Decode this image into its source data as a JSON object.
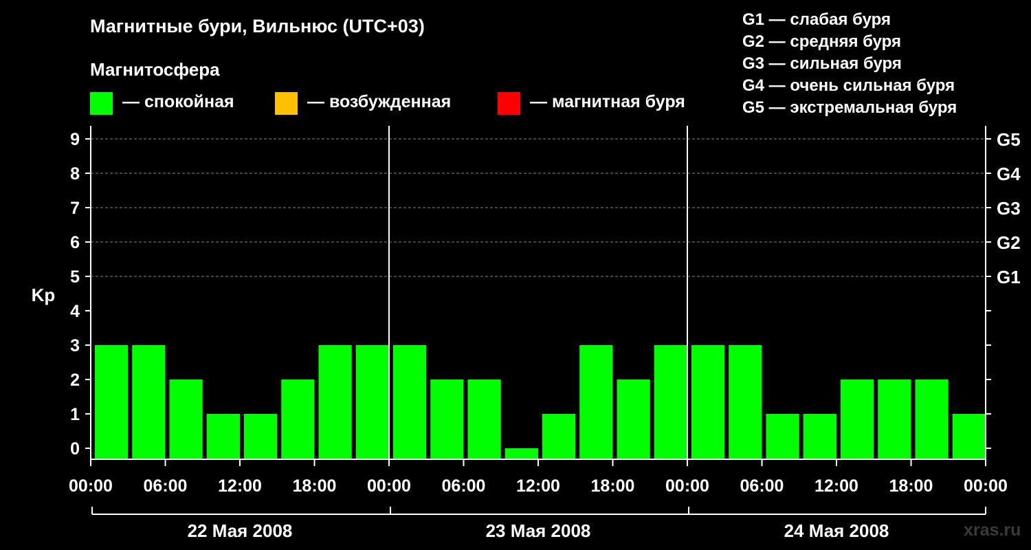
{
  "header": {
    "title": "Магнитные бури, Вильнюс (UTC+03)",
    "subtitle": "Магнитосфера"
  },
  "legend": [
    {
      "label": "— спокойная",
      "color": "#00ff00"
    },
    {
      "label": "— возбужденная",
      "color": "#ffc000"
    },
    {
      "label": "— магнитная буря",
      "color": "#ff0000"
    }
  ],
  "g_legend": [
    "G1 — слабая буря",
    "G2 — средняя буря",
    "G3 — сильная буря",
    "G4 — очень сильная буря",
    "G5 — экстремальная буря"
  ],
  "watermark": "xras.ru",
  "chart_data": {
    "type": "bar",
    "ylabel": "Kp",
    "ylim": [
      0,
      9
    ],
    "yticks": [
      "0",
      "1",
      "2",
      "3",
      "4",
      "5",
      "6",
      "7",
      "8",
      "9"
    ],
    "right_ticks": [
      {
        "value": 5,
        "label": "G1"
      },
      {
        "value": 6,
        "label": "G2"
      },
      {
        "value": 7,
        "label": "G3"
      },
      {
        "value": 8,
        "label": "G4"
      },
      {
        "value": 9,
        "label": "G5"
      }
    ],
    "x_tick_labels": [
      "00:00",
      "06:00",
      "12:00",
      "18:00",
      "00:00",
      "06:00",
      "12:00",
      "18:00",
      "00:00",
      "06:00",
      "12:00",
      "18:00",
      "00:00"
    ],
    "days": [
      "22 Мая 2008",
      "23 Мая 2008",
      "24 Мая 2008"
    ],
    "values": [
      3,
      3,
      2,
      1,
      1,
      2,
      3,
      3,
      3,
      2,
      2,
      0,
      1,
      3,
      2,
      3,
      3,
      3,
      1,
      1,
      2,
      2,
      2,
      1
    ],
    "bar_color": "#00ff00",
    "grid": "dashed at 5-9",
    "legend_position": "top"
  }
}
